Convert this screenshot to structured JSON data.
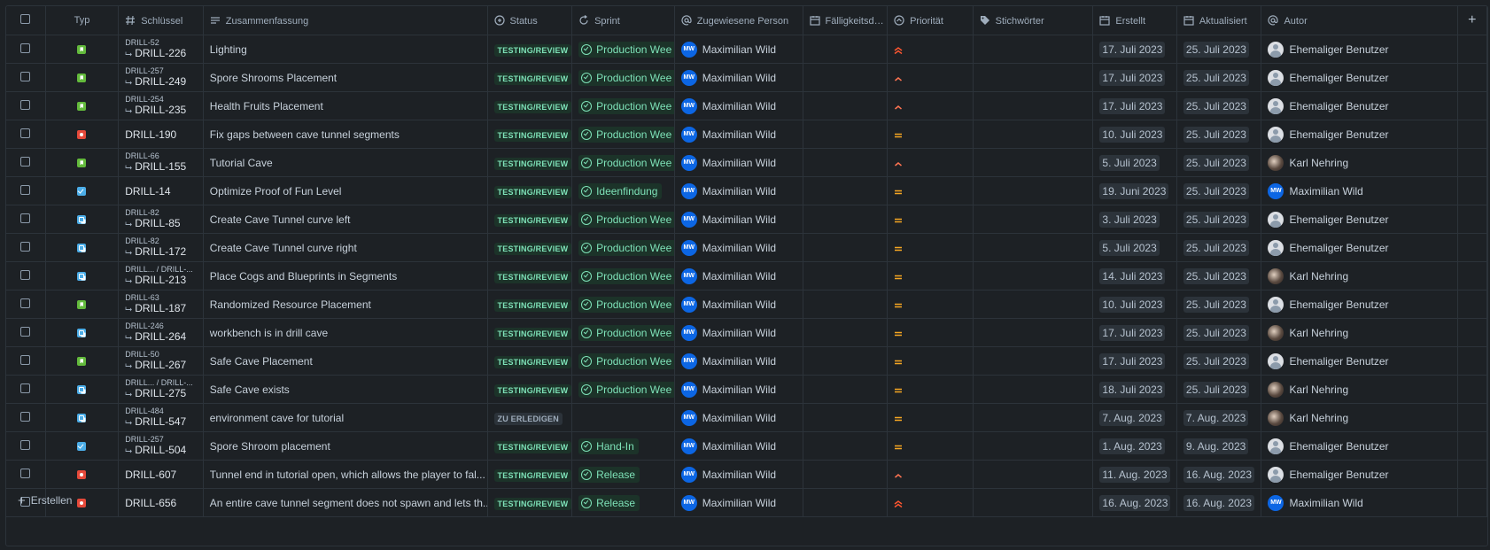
{
  "columns": {
    "type": "Typ",
    "key": "Schlüssel",
    "summary": "Zusammenfassung",
    "status": "Status",
    "sprint": "Sprint",
    "assignee": "Zugewiesene Person",
    "due": "Fälligkeitsd…",
    "priority": "Priorität",
    "labels": "Stichwörter",
    "created": "Erstellt",
    "updated": "Aktualisiert",
    "author": "Autor"
  },
  "footer": {
    "create_label": "Erstellen"
  },
  "rows": [
    {
      "type": "story",
      "parent": "DRILL-52",
      "key": "DRILL-226",
      "summary": "Lighting",
      "status": "TESTING/REVIEW",
      "sprint": "Production Wee",
      "assignee": "Maximilian Wild",
      "assignee_initials": "MW",
      "priority": "highest",
      "created": "17. Juli 2023",
      "updated": "25. Juli 2023",
      "author": "Ehemaliger Benutzer",
      "author_avatar": "generic"
    },
    {
      "type": "story",
      "parent": "DRILL-257",
      "key": "DRILL-249",
      "summary": "Spore Shrooms Placement",
      "status": "TESTING/REVIEW",
      "sprint": "Production Wee",
      "assignee": "Maximilian Wild",
      "assignee_initials": "MW",
      "priority": "high",
      "created": "17. Juli 2023",
      "updated": "25. Juli 2023",
      "author": "Ehemaliger Benutzer",
      "author_avatar": "generic"
    },
    {
      "type": "story",
      "parent": "DRILL-254",
      "key": "DRILL-235",
      "summary": "Health Fruits Placement",
      "status": "TESTING/REVIEW",
      "sprint": "Production Wee",
      "assignee": "Maximilian Wild",
      "assignee_initials": "MW",
      "priority": "high",
      "created": "17. Juli 2023",
      "updated": "25. Juli 2023",
      "author": "Ehemaliger Benutzer",
      "author_avatar": "generic"
    },
    {
      "type": "bug",
      "parent": "",
      "key": "DRILL-190",
      "summary": "Fix gaps between cave tunnel segments",
      "status": "TESTING/REVIEW",
      "sprint": "Production Wee",
      "assignee": "Maximilian Wild",
      "assignee_initials": "MW",
      "priority": "medium",
      "created": "10. Juli 2023",
      "updated": "25. Juli 2023",
      "author": "Ehemaliger Benutzer",
      "author_avatar": "generic"
    },
    {
      "type": "story",
      "parent": "DRILL-66",
      "key": "DRILL-155",
      "summary": "Tutorial Cave",
      "status": "TESTING/REVIEW",
      "sprint": "Production Wee",
      "assignee": "Maximilian Wild",
      "assignee_initials": "MW",
      "priority": "high",
      "created": "5. Juli 2023",
      "updated": "25. Juli 2023",
      "author": "Karl Nehring",
      "author_avatar": "photo"
    },
    {
      "type": "task",
      "parent": "",
      "key": "DRILL-14",
      "summary": "Optimize Proof of Fun Level",
      "status": "TESTING/REVIEW",
      "sprint": "Ideenfindung",
      "assignee": "Maximilian Wild",
      "assignee_initials": "MW",
      "priority": "medium",
      "created": "19. Juni 2023",
      "updated": "25. Juli 2023",
      "author": "Maximilian Wild",
      "author_avatar": "MW"
    },
    {
      "type": "subtask",
      "parent": "DRILL-82",
      "key": "DRILL-85",
      "summary": "Create Cave Tunnel curve left",
      "status": "TESTING/REVIEW",
      "sprint": "Production Wee",
      "assignee": "Maximilian Wild",
      "assignee_initials": "MW",
      "priority": "medium",
      "created": "3. Juli 2023",
      "updated": "25. Juli 2023",
      "author": "Ehemaliger Benutzer",
      "author_avatar": "generic"
    },
    {
      "type": "subtask",
      "parent": "DRILL-82",
      "key": "DRILL-172",
      "summary": "Create Cave Tunnel curve right",
      "status": "TESTING/REVIEW",
      "sprint": "Production Wee",
      "assignee": "Maximilian Wild",
      "assignee_initials": "MW",
      "priority": "medium",
      "created": "5. Juli 2023",
      "updated": "25. Juli 2023",
      "author": "Ehemaliger Benutzer",
      "author_avatar": "generic"
    },
    {
      "type": "subtask",
      "parent": "DRILL...   / DRILL-...",
      "key": "DRILL-213",
      "summary": "Place Cogs and Blueprints in Segments",
      "status": "TESTING/REVIEW",
      "sprint": "Production Wee",
      "assignee": "Maximilian Wild",
      "assignee_initials": "MW",
      "priority": "medium",
      "created": "14. Juli 2023",
      "updated": "25. Juli 2023",
      "author": "Karl Nehring",
      "author_avatar": "photo"
    },
    {
      "type": "story",
      "parent": "DRILL-63",
      "key": "DRILL-187",
      "summary": "Randomized Resource Placement",
      "status": "TESTING/REVIEW",
      "sprint": "Production Wee",
      "assignee": "Maximilian Wild",
      "assignee_initials": "MW",
      "priority": "medium",
      "created": "10. Juli 2023",
      "updated": "25. Juli 2023",
      "author": "Ehemaliger Benutzer",
      "author_avatar": "generic"
    },
    {
      "type": "subtask",
      "parent": "DRILL-246",
      "key": "DRILL-264",
      "summary": "workbench is in drill cave",
      "status": "TESTING/REVIEW",
      "sprint": "Production Wee",
      "assignee": "Maximilian Wild",
      "assignee_initials": "MW",
      "priority": "medium",
      "created": "17. Juli 2023",
      "updated": "25. Juli 2023",
      "author": "Karl Nehring",
      "author_avatar": "photo"
    },
    {
      "type": "story",
      "parent": "DRILL-50",
      "key": "DRILL-267",
      "summary": "Safe Cave Placement",
      "status": "TESTING/REVIEW",
      "sprint": "Production Wee",
      "assignee": "Maximilian Wild",
      "assignee_initials": "MW",
      "priority": "medium",
      "created": "17. Juli 2023",
      "updated": "25. Juli 2023",
      "author": "Ehemaliger Benutzer",
      "author_avatar": "generic"
    },
    {
      "type": "subtask",
      "parent": "DRILL...   / DRILL-...",
      "key": "DRILL-275",
      "summary": "Safe Cave exists",
      "status": "TESTING/REVIEW",
      "sprint": "Production Wee",
      "assignee": "Maximilian Wild",
      "assignee_initials": "MW",
      "priority": "medium",
      "created": "18. Juli 2023",
      "updated": "25. Juli 2023",
      "author": "Karl Nehring",
      "author_avatar": "photo"
    },
    {
      "type": "subtask",
      "parent": "DRILL-484",
      "key": "DRILL-547",
      "summary": "environment cave for tutorial",
      "status": "ZU ERLEDIGEN",
      "sprint": "",
      "assignee": "Maximilian Wild",
      "assignee_initials": "MW",
      "priority": "medium",
      "created": "7. Aug. 2023",
      "updated": "7. Aug. 2023",
      "author": "Karl Nehring",
      "author_avatar": "photo"
    },
    {
      "type": "task",
      "parent": "DRILL-257",
      "key": "DRILL-504",
      "summary": "Spore Shroom placement",
      "status": "TESTING/REVIEW",
      "sprint": "Hand-In",
      "assignee": "Maximilian Wild",
      "assignee_initials": "MW",
      "priority": "medium",
      "created": "1. Aug. 2023",
      "updated": "9. Aug. 2023",
      "author": "Ehemaliger Benutzer",
      "author_avatar": "generic"
    },
    {
      "type": "bug",
      "parent": "",
      "key": "DRILL-607",
      "summary": "Tunnel end in tutorial open, which allows the player to fal...",
      "status": "TESTING/REVIEW",
      "sprint": "Release",
      "assignee": "Maximilian Wild",
      "assignee_initials": "MW",
      "priority": "high",
      "created": "11. Aug. 2023",
      "updated": "16. Aug. 2023",
      "author": "Ehemaliger Benutzer",
      "author_avatar": "generic"
    },
    {
      "type": "bug",
      "parent": "",
      "key": "DRILL-656",
      "summary": "An entire cave tunnel segment does not spawn and lets th...",
      "status": "TESTING/REVIEW",
      "sprint": "Release",
      "assignee": "Maximilian Wild",
      "assignee_initials": "MW",
      "priority": "highest",
      "created": "16. Aug. 2023",
      "updated": "16. Aug. 2023",
      "author": "Maximilian Wild",
      "author_avatar": "MW"
    }
  ]
}
